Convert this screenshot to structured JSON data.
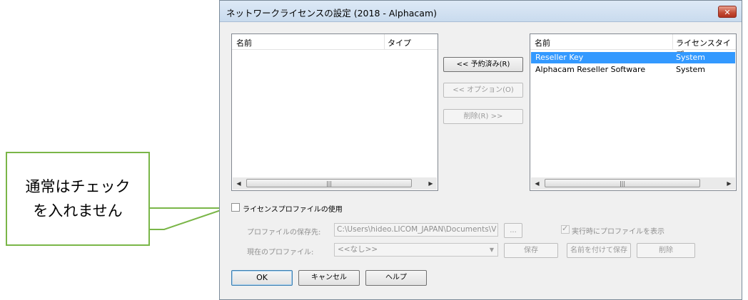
{
  "callout": {
    "text_line1": "通常はチェック",
    "text_line2": "を入れません"
  },
  "dialog": {
    "title": "ネットワークライセンスの設定 (2018 - Alphacam)",
    "close_label": "✕",
    "left_list": {
      "col_name": "名前",
      "col_type": "タイプ"
    },
    "right_list": {
      "col_name": "名前",
      "col_type": "ライセンスタイプ",
      "rows": [
        {
          "name": "Reseller Key",
          "type": "System"
        },
        {
          "name": "Alphacam Reseller Software",
          "type": "System"
        }
      ]
    },
    "reserved_button": "<< 予約済み(R)",
    "option_button": "<< オプション(O)",
    "delete_right_button": "削除(R) >>",
    "scroll_left": "◀",
    "scroll_right": "▶",
    "scroll_grip": "|||",
    "use_profile_label": "ライセンスプロファイルの使用",
    "profile_location_label": "プロファイルの保存先:",
    "profile_location_value": "C:\\Users\\hideo.LICOM_JAPAN\\Documents\\V",
    "browse_button": "...",
    "show_profile_label": "実行時にプロファイルを表示",
    "current_profile_label": "現在のプロファイル:",
    "current_profile_value": "<<なし>>",
    "combo_arrow": "▼",
    "save_button": "保存",
    "save_as_button": "名前を付けて保存",
    "delete_button": "削除",
    "ok_button": "OK",
    "cancel_button": "キャンセル",
    "help_button": "ヘルプ"
  }
}
